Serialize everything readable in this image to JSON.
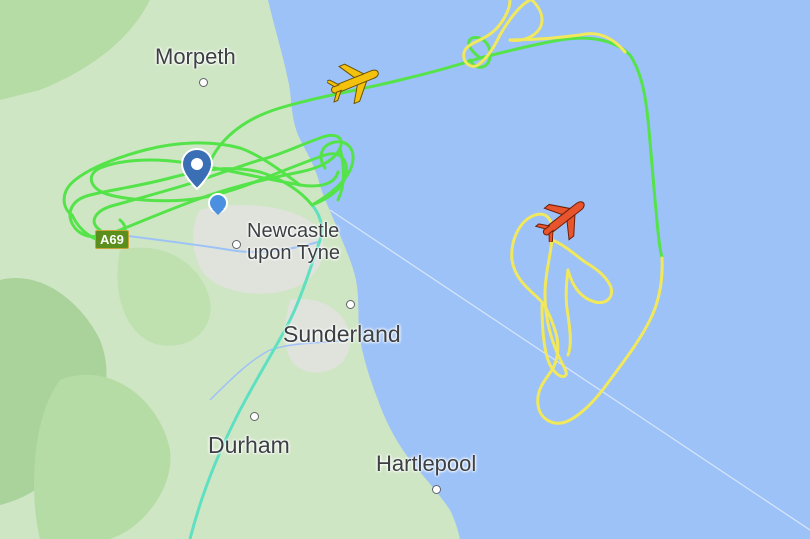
{
  "map": {
    "places": [
      {
        "name": "Morpeth"
      },
      {
        "name": "Newcastle\nupon Tyne"
      },
      {
        "name": "Sunderland"
      },
      {
        "name": "Durham"
      },
      {
        "name": "Hartlepool"
      }
    ],
    "road_shield": "A69",
    "colors": {
      "sea": "#9dc2f7",
      "land": "#cfe6c4",
      "forest": "#a9d39b",
      "green_track": "#55e34a",
      "yellow_track": "#f2e85c",
      "teal_track": "#5fe0c2",
      "aircraft_yellow": "#f4c20d",
      "aircraft_red": "#e8542b",
      "pin_blue": "#3a6fb5",
      "dot_blue": "#4a8fe0"
    },
    "icons": {
      "aircraft_1": "airplane-icon",
      "aircraft_2": "airplane-icon",
      "pin": "location-pin-icon",
      "dot": "location-dot-icon"
    }
  }
}
